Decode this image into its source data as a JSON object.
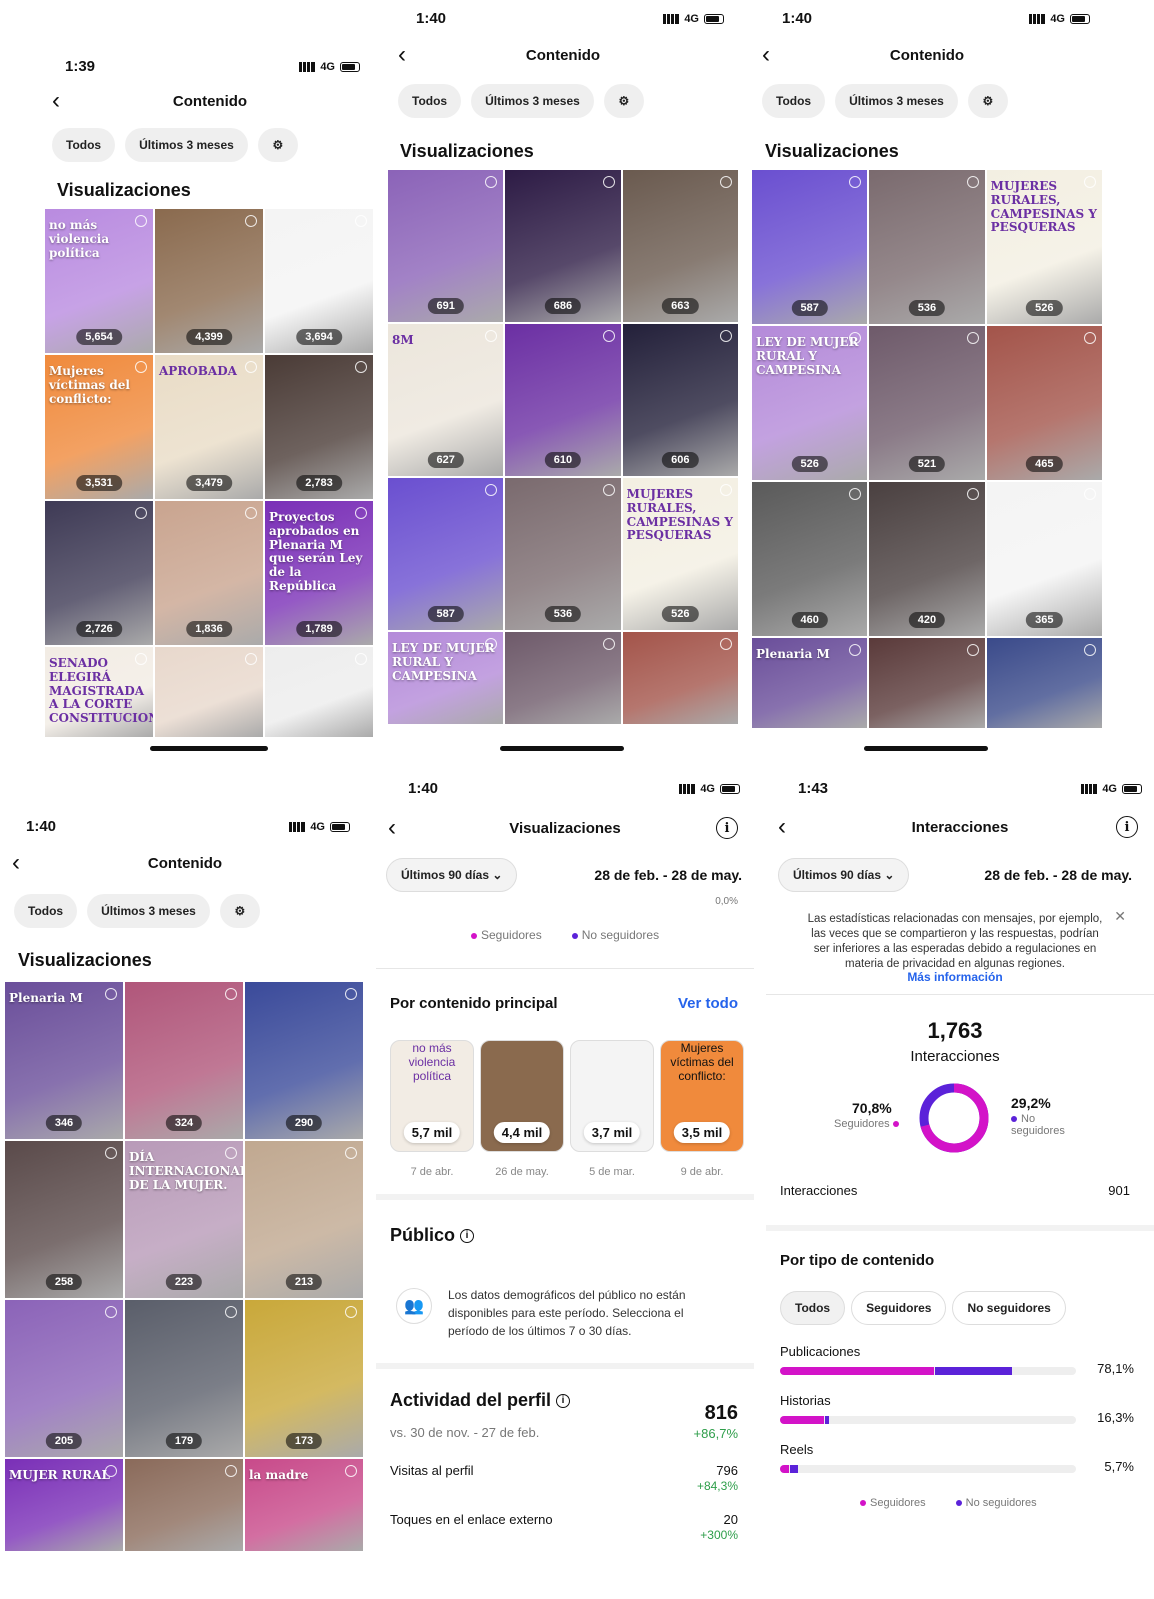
{
  "colors": {
    "accent": "#d313c8",
    "secondary": "#5b22d9",
    "link": "#2563eb",
    "positive": "#2e9e4a"
  },
  "screens": [
    {
      "time": "1:39",
      "network": "4G",
      "title": "Contenido",
      "filters": [
        "Todos",
        "Últimos 3 meses"
      ],
      "section": "Visualizaciones",
      "tiles": [
        {
          "c": "5,654",
          "cap": "no más violencia política"
        },
        {
          "c": "4,399"
        },
        {
          "c": "3,694"
        },
        {
          "c": "3,531",
          "cap": "Mujeres víctimas del conflicto:"
        },
        {
          "c": "3,479",
          "cap": "APROBADA"
        },
        {
          "c": "2,783"
        },
        {
          "c": "2,726"
        },
        {
          "c": "1,836"
        },
        {
          "c": "1,789",
          "cap": "Proyectos aprobados en Plenaria M que serán Ley de la República"
        },
        {
          "c": "",
          "cap": "SENADO ELEGIRÁ MAGISTRADA A LA CORTE CONSTITUCIONAL"
        },
        {
          "c": ""
        },
        {
          "c": ""
        }
      ]
    },
    {
      "time": "1:40",
      "network": "4G",
      "title": "Contenido",
      "filters": [
        "Todos",
        "Últimos 3 meses"
      ],
      "section": "Visualizaciones",
      "tiles": [
        {
          "c": "691"
        },
        {
          "c": "686"
        },
        {
          "c": "663"
        },
        {
          "c": "627",
          "cap": "8M"
        },
        {
          "c": "610"
        },
        {
          "c": "606"
        },
        {
          "c": "587"
        },
        {
          "c": "536"
        },
        {
          "c": "526",
          "cap": "MUJERES RURALES, CAMPESINAS Y PESQUERAS"
        },
        {
          "c": "",
          "cap": "LEY DE MUJER RURAL Y CAMPESINA"
        },
        {
          "c": ""
        },
        {
          "c": ""
        }
      ]
    },
    {
      "time": "1:40",
      "network": "4G",
      "title": "Contenido",
      "filters": [
        "Todos",
        "Últimos 3 meses"
      ],
      "section": "Visualizaciones",
      "tiles": [
        {
          "c": "587"
        },
        {
          "c": "536"
        },
        {
          "c": "526",
          "cap": "MUJERES RURALES, CAMPESINAS Y PESQUERAS"
        },
        {
          "c": "526",
          "cap": "LEY DE MUJER RURAL Y CAMPESINA"
        },
        {
          "c": "521"
        },
        {
          "c": "465"
        },
        {
          "c": "460"
        },
        {
          "c": "420"
        },
        {
          "c": "365"
        },
        {
          "c": "",
          "cap": "Plenaria M"
        },
        {
          "c": ""
        },
        {
          "c": ""
        }
      ]
    },
    {
      "time": "1:40",
      "network": "4G",
      "title": "Contenido",
      "filters": [
        "Todos",
        "Últimos 3 meses"
      ],
      "section": "Visualizaciones",
      "tiles": [
        {
          "c": "346",
          "cap": "Plenaria M"
        },
        {
          "c": "324"
        },
        {
          "c": "290"
        },
        {
          "c": "258"
        },
        {
          "c": "223",
          "cap": "DÍA INTERNACIONAL DE LA MUJER."
        },
        {
          "c": "213"
        },
        {
          "c": "205"
        },
        {
          "c": "179"
        },
        {
          "c": "173"
        },
        {
          "c": "",
          "cap": "MUJER RURAL"
        },
        {
          "c": ""
        },
        {
          "c": "",
          "cap": "la madre"
        }
      ]
    }
  ],
  "views": {
    "time": "1:40",
    "network": "4G",
    "title": "Visualizaciones",
    "period": "Últimos 90 días",
    "range": "28 de feb. - 28 de may.",
    "top_pct": "0,0%",
    "legend": [
      "Seguidores",
      "No seguidores"
    ],
    "top_title": "Por contenido principal",
    "see_all": "Ver todo",
    "top": [
      {
        "v": "5,7 mil",
        "d": "7 de abr.",
        "cap": "no más violencia política"
      },
      {
        "v": "4,4 mil",
        "d": "26 de may."
      },
      {
        "v": "3,7 mil",
        "d": "5 de mar."
      },
      {
        "v": "3,5 mil",
        "d": "9 de abr.",
        "cap": "Mujeres víctimas del conflicto:"
      }
    ],
    "public_title": "Público",
    "public_msg": "Los datos demográficos del público no están disponibles para este período. Selecciona el período de los últimos 7 o 30 días.",
    "activity_title": "Actividad del perfil",
    "activity_vs": "vs. 30 de nov. - 27 de feb.",
    "activity_total": "816",
    "activity_change": "+86,7%",
    "rows": [
      {
        "l": "Visitas al perfil",
        "v": "796",
        "c": "+84,3%"
      },
      {
        "l": "Toques en el enlace externo",
        "v": "20",
        "c": "+300%"
      }
    ]
  },
  "inter": {
    "time": "1:43",
    "network": "4G",
    "title": "Interacciones",
    "period": "Últimos 90 días",
    "range": "28 de feb. - 28 de may.",
    "notice": "Las estadísticas relacionadas con mensajes, por ejemplo, las veces que se compartieron y las respuestas, podrían ser inferiores a las esperadas debido a regulaciones en materia de privacidad en algunas regiones.",
    "more": "Más información",
    "total": "1,763",
    "total_label": "Interacciones",
    "followers_pct": "70,8%",
    "followers_label": "Seguidores",
    "nonf_pct": "29,2%",
    "nonf_label": "No seguidores",
    "followers_frac": 0.708,
    "row_label": "Interacciones",
    "row_value": "901",
    "type_title": "Por tipo de contenido",
    "type_filters": [
      "Todos",
      "Seguidores",
      "No seguidores"
    ],
    "types": [
      {
        "l": "Publicaciones",
        "p": "78,1%",
        "a": 0.52,
        "b": 0.26
      },
      {
        "l": "Historias",
        "p": "16,3%",
        "a": 0.15,
        "b": 0.013
      },
      {
        "l": "Reels",
        "p": "5,7%",
        "a": 0.03,
        "b": 0.027
      }
    ],
    "legend": [
      "Seguidores",
      "No seguidores"
    ]
  }
}
